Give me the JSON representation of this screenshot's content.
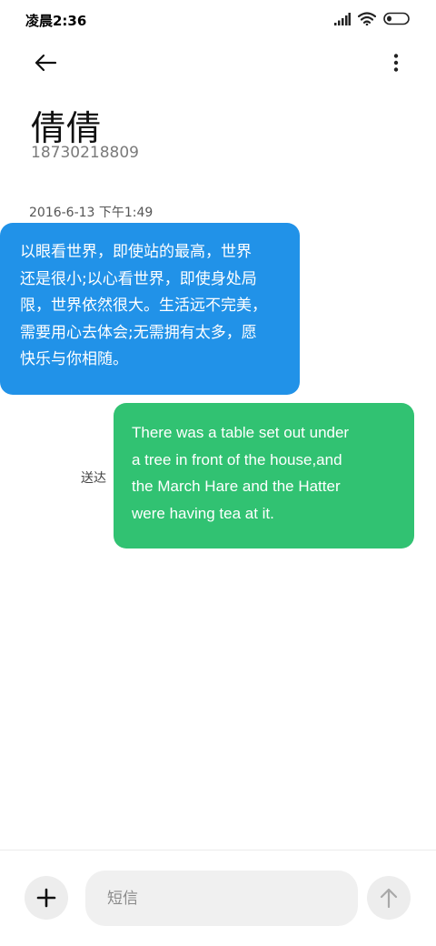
{
  "status_bar": {
    "time": "凌晨2:36",
    "icons": [
      "signal-icon",
      "wifi-icon",
      "battery-icon"
    ]
  },
  "header": {
    "back_icon": "arrow-left-icon",
    "more_icon": "more-vertical-icon"
  },
  "contact": {
    "name": "倩倩",
    "number": "18730218809"
  },
  "thread": {
    "date": "2016-6-13 下午1:49",
    "messages": [
      {
        "direction": "incoming",
        "lines": [
          "以眼看世界，即使站的最高，世界",
          "还是很小;以心看世界，即使身处局",
          "限，世界依然很大。生活远不完美，",
          "需要用心去体会;无需拥有太多，愿",
          "快乐与你相随。"
        ]
      },
      {
        "direction": "outgoing",
        "lines": [
          "There was a table set out under",
          "a tree in front of the house,and",
          "the March Hare and the Hatter",
          "were having tea at it."
        ],
        "status": "送达"
      }
    ]
  },
  "composer": {
    "placeholder": "短信",
    "value": "",
    "add_icon": "plus-icon",
    "send_icon": "arrow-up-icon"
  },
  "colors": {
    "incoming_bubble": "#2192e8",
    "outgoing_bubble": "#31c272",
    "background": "#ffffff"
  }
}
